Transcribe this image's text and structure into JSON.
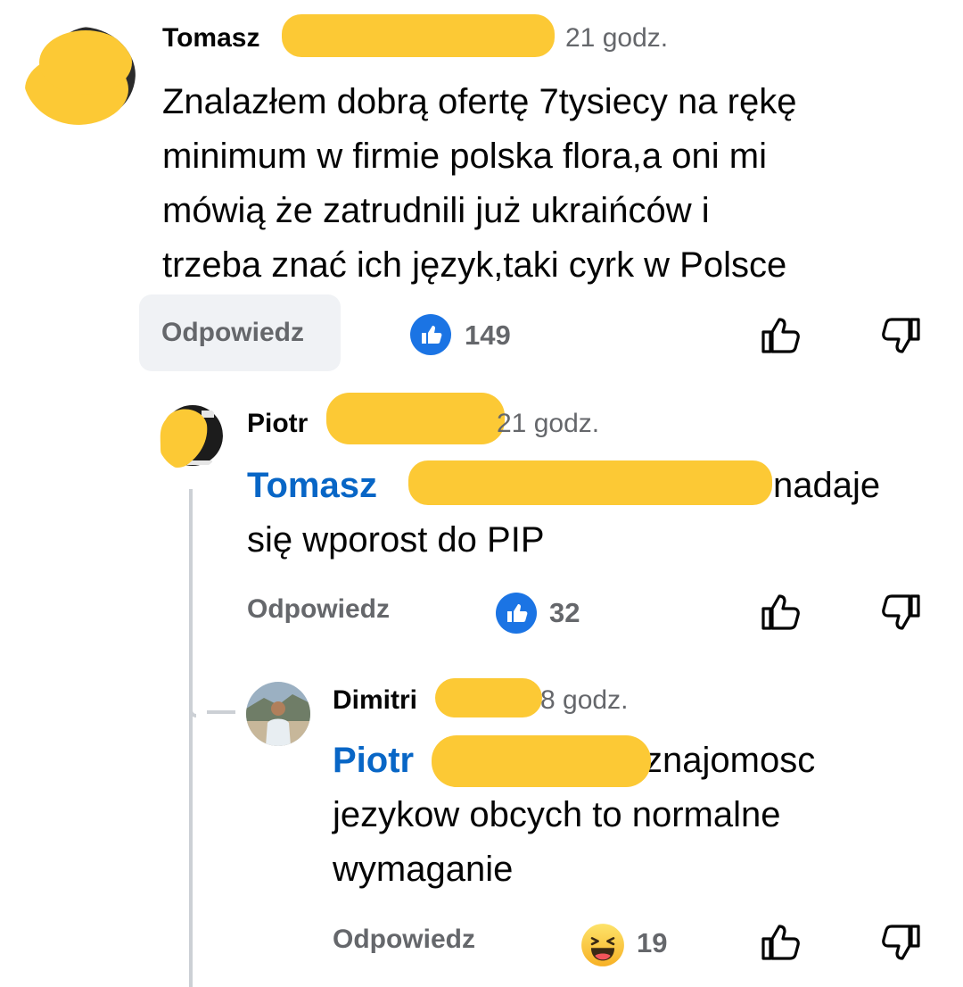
{
  "comments": [
    {
      "author": "Tomasz",
      "time": "21 godz.",
      "text_lines": [
        "Znalazłem dobrą ofertę 7tysiecy na rękę",
        "minimum w firmie polska flora,a oni mi",
        "mówią że zatrudnili już ukraińców i",
        "trzeba znać ich język,taki cyrk w Polsce"
      ],
      "reply_label": "Odpowiedz",
      "reaction": "like",
      "reaction_count": "149"
    },
    {
      "author": "Piotr",
      "time": "21 godz.",
      "mention": "Tomasz",
      "text_line1_rest": "nadaje",
      "text_line2": "się wporost do PIP",
      "reply_label": "Odpowiedz",
      "reaction": "like",
      "reaction_count": "32"
    },
    {
      "author": "Dimitri",
      "time": "8 godz.",
      "mention": "Piotr",
      "text_line1_rest": "znajomosc",
      "text_line2": "jezykow obcych to normalne",
      "text_line3": "wymaganie",
      "reply_label": "Odpowiedz",
      "reaction": "haha",
      "reaction_count": "19"
    }
  ],
  "colors": {
    "like_blue": "#1b74e4",
    "mention_blue": "#0866c6",
    "redaction_yellow": "#fcc935",
    "secondary_text": "#65676b"
  },
  "icons": [
    "thumbs-up-icon",
    "thumbs-down-icon",
    "like-reaction-icon",
    "haha-reaction-icon"
  ]
}
